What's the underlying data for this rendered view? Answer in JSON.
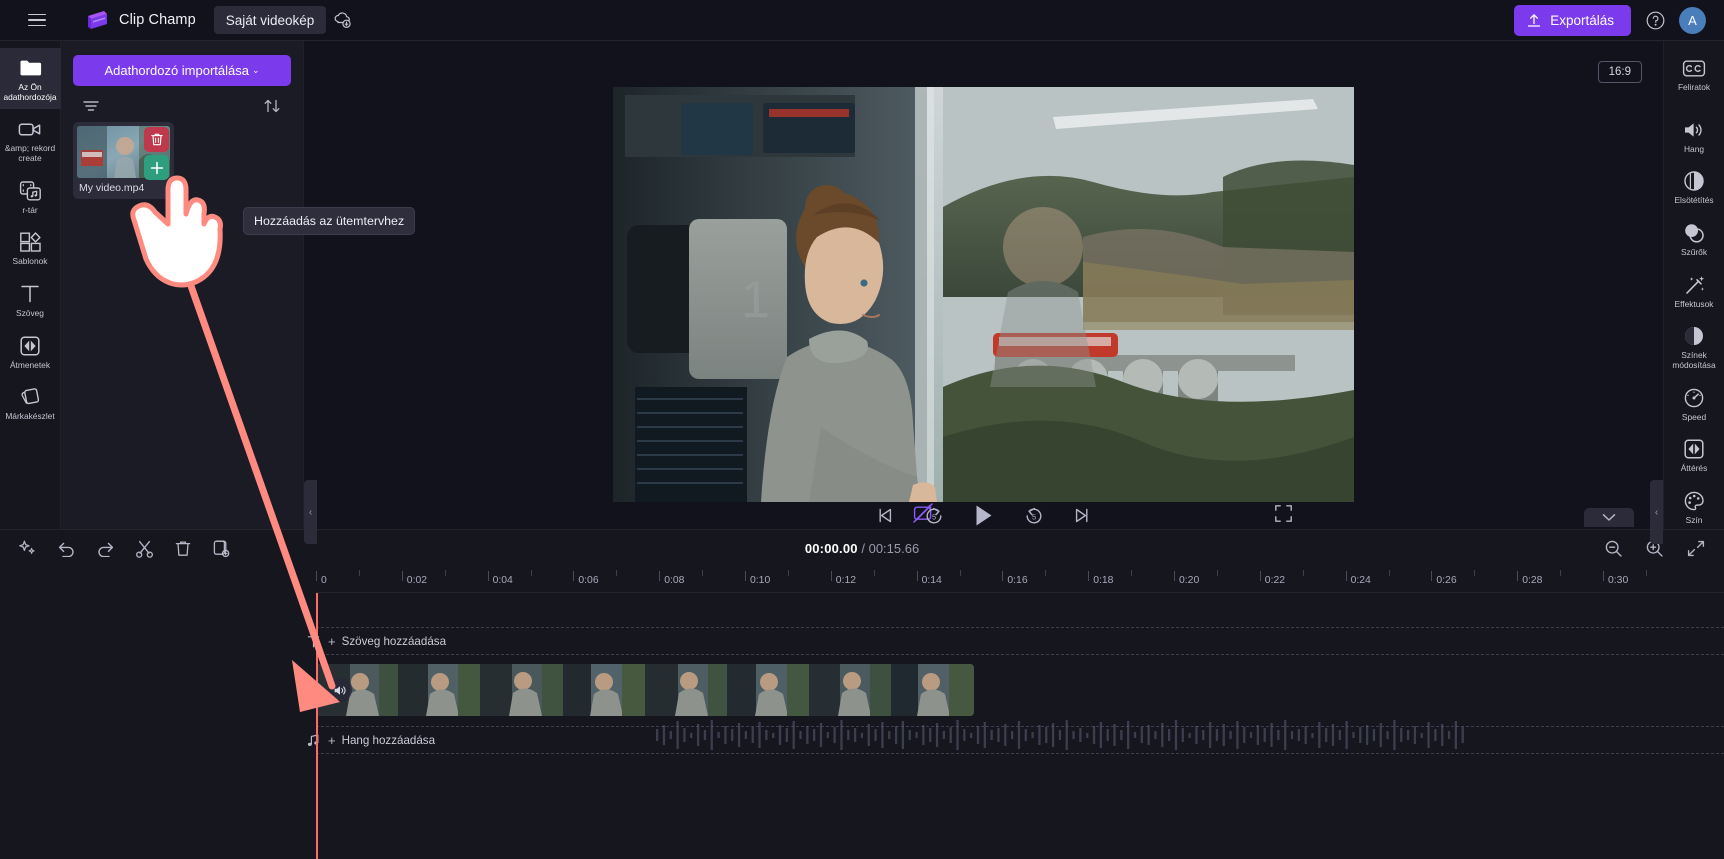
{
  "app": {
    "brand_name": "Clip Champ",
    "project_name": "Saját videokép",
    "menu_icon": "hamburger-icon",
    "cloud_icon": "cloud-sync-icon"
  },
  "topbar": {
    "export_label": "Exportálás",
    "export_icon": "upload-icon",
    "help_icon": "help-circle-icon",
    "avatar_initial": "A"
  },
  "left_rail": {
    "items": [
      {
        "label": "Az Ön adathordozója",
        "icon": "folder-icon",
        "active": true
      },
      {
        "label": "&amp; rekord create",
        "icon": "video-camera-icon",
        "active": false
      },
      {
        "label": "r-tár",
        "icon": "media-library-icon",
        "active": false
      },
      {
        "label": "Sablonok",
        "icon": "templates-icon",
        "active": false
      },
      {
        "label": "Szöveg",
        "icon": "text-icon",
        "active": false
      },
      {
        "label": "Átmenetek",
        "icon": "transitions-icon",
        "active": false
      },
      {
        "label": "Márkakészlet",
        "icon": "brand-kit-icon",
        "active": false
      }
    ]
  },
  "media_panel": {
    "import_label": "Adathordozó importálása",
    "import_caret": "⌄",
    "filter_icon": "filter-icon",
    "sort_icon": "sort-icon",
    "items": [
      {
        "name": "My video.mp4",
        "delete_icon": "trash-icon",
        "add_icon": "plus-icon"
      }
    ],
    "tooltip": "Hozzáadás az ütemtervhez"
  },
  "preview": {
    "aspect_ratio": "16:9",
    "magic_icon": "magic-wand-off-icon",
    "fullscreen_icon": "fullscreen-icon",
    "controls": [
      {
        "name": "skip-to-start",
        "icon": "skip-previous-icon"
      },
      {
        "name": "rewind-5",
        "icon": "replay-5-icon"
      },
      {
        "name": "play",
        "icon": "play-icon"
      },
      {
        "name": "forward-5",
        "icon": "forward-5-icon"
      },
      {
        "name": "skip-to-end",
        "icon": "skip-next-icon"
      }
    ]
  },
  "right_rail": {
    "items": [
      {
        "label": "Feliratok",
        "icon": "closed-caption-icon"
      },
      {
        "label": "Hang",
        "icon": "speaker-icon"
      },
      {
        "label": "Elsötétítés",
        "icon": "fade-icon"
      },
      {
        "label": "Szűrők",
        "icon": "filters-icon"
      },
      {
        "label": "Effektusok",
        "icon": "effects-icon"
      },
      {
        "label": "Színek módosítása",
        "icon": "color-adjust-icon"
      },
      {
        "label": "Speed",
        "icon": "speed-icon"
      },
      {
        "label": "Áttérés",
        "icon": "transition-icon"
      },
      {
        "label": "Szín",
        "icon": "palette-icon"
      }
    ]
  },
  "timeline": {
    "tools": [
      {
        "name": "ai-suggest-button",
        "icon": "sparkle-icon"
      },
      {
        "name": "undo-button",
        "icon": "undo-icon"
      },
      {
        "name": "redo-button",
        "icon": "redo-icon"
      },
      {
        "name": "split-button",
        "icon": "scissors-icon"
      },
      {
        "name": "delete-button",
        "icon": "trash-icon"
      },
      {
        "name": "duplicate-button",
        "icon": "duplicate-icon"
      }
    ],
    "current_time": "00:00.00",
    "total_time": "/ 00:15.66",
    "zoom_out_icon": "zoom-out-icon",
    "zoom_in_icon": "zoom-in-icon",
    "fit_icon": "fit-to-screen-icon",
    "ruler_labels": [
      "0",
      "0:02",
      "0:04",
      "0:06",
      "0:08",
      "0:10",
      "0:12",
      "0:14",
      "0:16",
      "0:18",
      "0:20",
      "0:22",
      "0:24",
      "0:26",
      "0:28",
      "0:30"
    ],
    "text_track": {
      "label": "Szöveg hozzáadása",
      "icon": "text-icon",
      "plus": "+"
    },
    "audio_track": {
      "label": "Hang hozzáadása",
      "icon": "music-note-icon",
      "plus": "+"
    },
    "video_clip": {
      "audio_icon": "volume-icon",
      "frames": 8
    },
    "collapse_icon": "chevron-down-icon"
  },
  "panel_handles": {
    "left_collapse": "‹",
    "right_collapse": "‹"
  },
  "colors": {
    "accent": "#7c3aed",
    "delete": "#c0384b",
    "add": "#2f9e7f",
    "playhead": "#ff6b6b",
    "bg": "#12121c",
    "panel": "#1b1b26"
  }
}
